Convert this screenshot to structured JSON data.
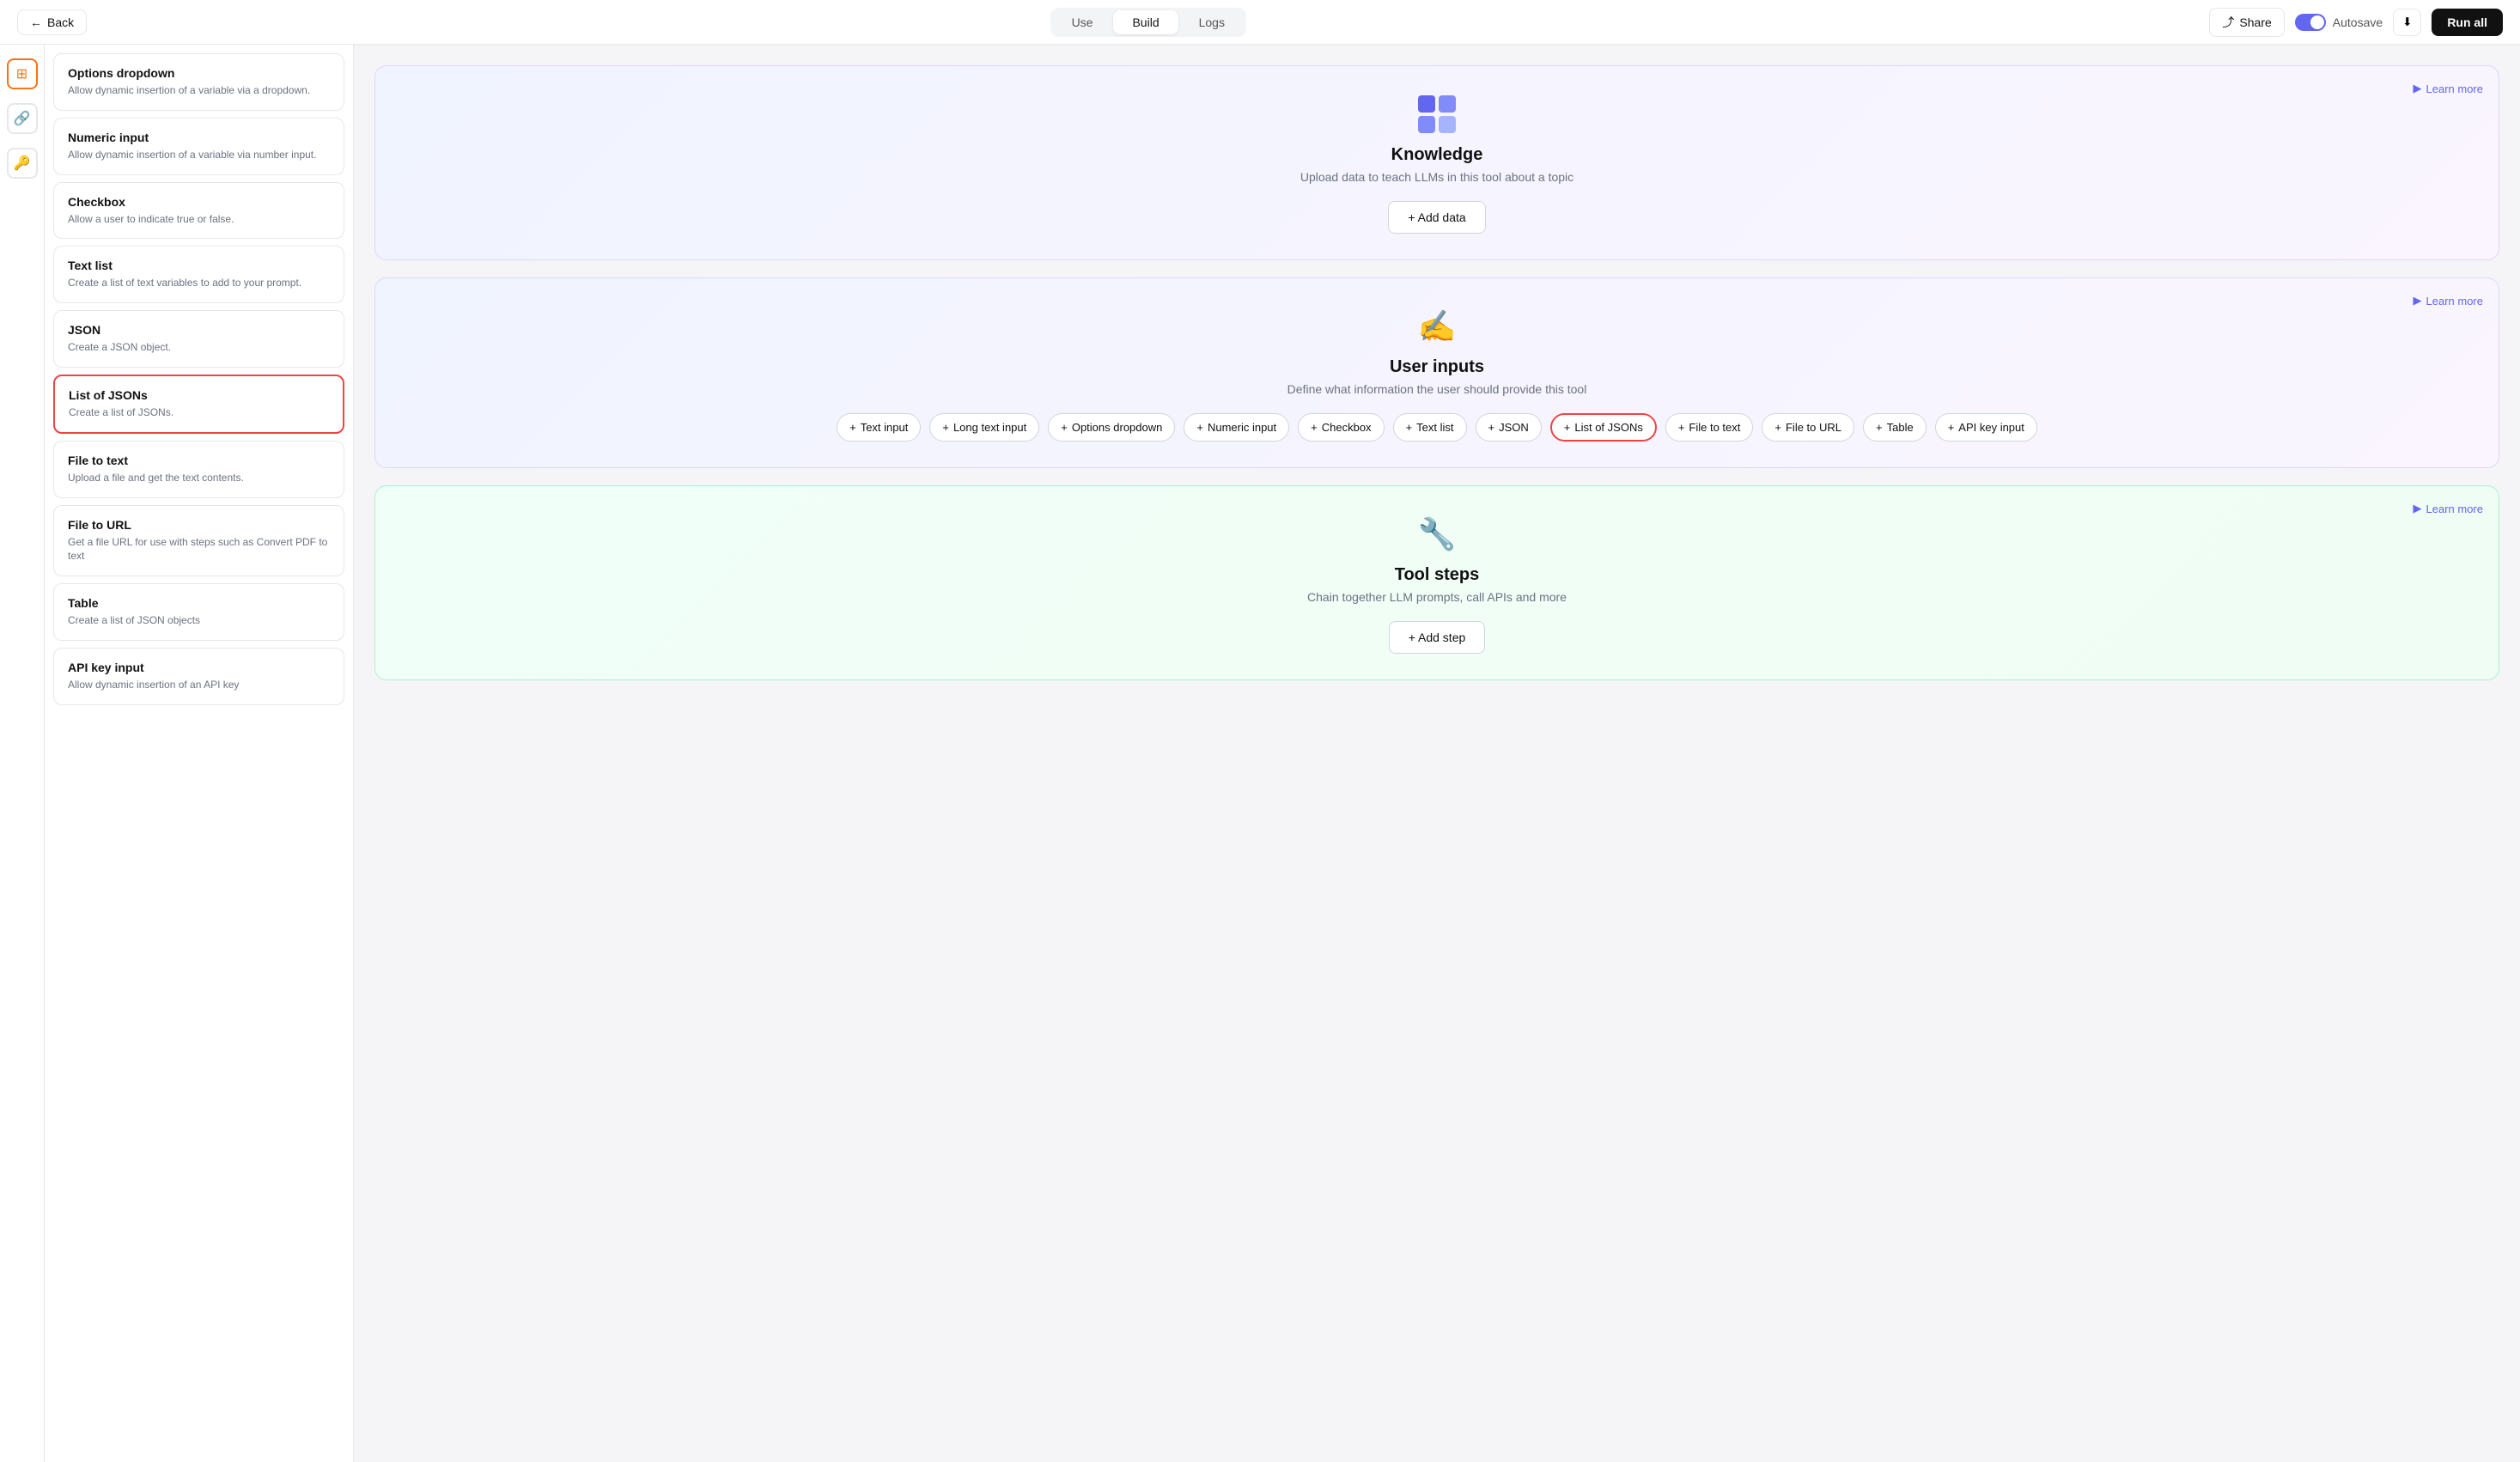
{
  "nav": {
    "back_label": "Back",
    "tabs": [
      {
        "id": "use",
        "label": "Use"
      },
      {
        "id": "build",
        "label": "Build",
        "active": true
      },
      {
        "id": "logs",
        "label": "Logs"
      }
    ],
    "share_label": "Share",
    "autosave_label": "Autosave",
    "run_all_label": "Run all"
  },
  "sidebar": {
    "items": [
      {
        "id": "options-dropdown",
        "title": "Options dropdown",
        "desc": "Allow dynamic insertion of a variable via a dropdown.",
        "selected": false
      },
      {
        "id": "numeric-input",
        "title": "Numeric input",
        "desc": "Allow dynamic insertion of a variable via number input.",
        "selected": false
      },
      {
        "id": "checkbox",
        "title": "Checkbox",
        "desc": "Allow a user to indicate true or false.",
        "selected": false
      },
      {
        "id": "text-list",
        "title": "Text list",
        "desc": "Create a list of text variables to add to your prompt.",
        "selected": false
      },
      {
        "id": "json",
        "title": "JSON",
        "desc": "Create a JSON object.",
        "selected": false
      },
      {
        "id": "list-of-jsons",
        "title": "List of JSONs",
        "desc": "Create a list of JSONs.",
        "selected": true
      },
      {
        "id": "file-to-text",
        "title": "File to text",
        "desc": "Upload a file and get the text contents.",
        "selected": false
      },
      {
        "id": "file-to-url",
        "title": "File to URL",
        "desc": "Get a file URL for use with steps such as Convert PDF to text",
        "selected": false
      },
      {
        "id": "table",
        "title": "Table",
        "desc": "Create a list of JSON objects",
        "selected": false
      },
      {
        "id": "api-key-input",
        "title": "API key input",
        "desc": "Allow dynamic insertion of an API key",
        "selected": false
      }
    ]
  },
  "knowledge": {
    "icon": "🟦",
    "title": "Knowledge",
    "subtitle": "Upload data to teach LLMs in this tool about a topic",
    "learn_more": "Learn more",
    "add_data": "+ Add data"
  },
  "user_inputs": {
    "icon": "✍️",
    "title": "User inputs",
    "subtitle": "Define what information the user should provide this tool",
    "learn_more": "Learn more",
    "chips": [
      {
        "id": "text-input",
        "label": "Text input",
        "highlighted": false
      },
      {
        "id": "long-text-input",
        "label": "Long text input",
        "highlighted": false
      },
      {
        "id": "options-dropdown",
        "label": "Options dropdown",
        "highlighted": false
      },
      {
        "id": "numeric-input",
        "label": "Numeric input",
        "highlighted": false
      },
      {
        "id": "checkbox",
        "label": "Checkbox",
        "highlighted": false
      },
      {
        "id": "text-list",
        "label": "Text list",
        "highlighted": false
      },
      {
        "id": "json",
        "label": "JSON",
        "highlighted": false
      },
      {
        "id": "list-of-jsons",
        "label": "List of JSONs",
        "highlighted": true
      },
      {
        "id": "file-to-text",
        "label": "File to text",
        "highlighted": false
      },
      {
        "id": "file-to-url",
        "label": "File to URL",
        "highlighted": false
      },
      {
        "id": "table",
        "label": "Table",
        "highlighted": false
      },
      {
        "id": "api-key-input",
        "label": "API key input",
        "highlighted": false
      }
    ]
  },
  "tool_steps": {
    "icon": "🔧",
    "title": "Tool steps",
    "subtitle": "Chain together LLM prompts, call APIs and more",
    "learn_more": "Learn more",
    "add_step": "+ Add step"
  }
}
